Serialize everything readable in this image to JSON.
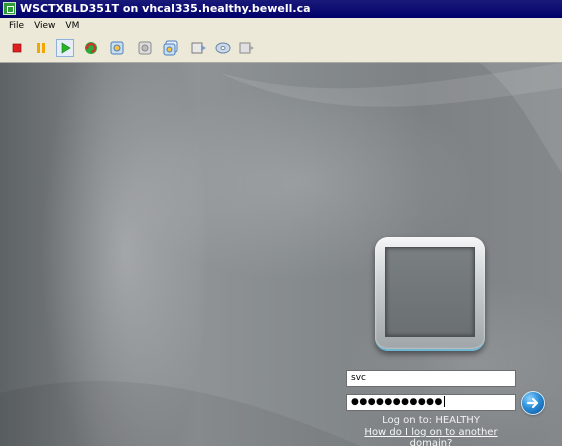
{
  "window": {
    "title": "WSCTXBLD351T on vhcal335.healthy.bewell.ca",
    "icon": "vm-console-icon"
  },
  "menu": {
    "items": [
      "File",
      "View",
      "VM"
    ]
  },
  "toolbar": {
    "buttons": [
      {
        "name": "power-off",
        "icon": "stop-icon",
        "color": "#e02020"
      },
      {
        "name": "suspend",
        "icon": "pause-icon",
        "color": "#f0a800"
      },
      {
        "name": "power-on",
        "icon": "play-icon",
        "color": "#28b428"
      },
      {
        "name": "reset",
        "icon": "reset-icon",
        "color": "#d03030"
      },
      {
        "name": "snapshot",
        "icon": "snapshot-icon"
      },
      {
        "name": "revert-snapshot",
        "icon": "revert-snapshot-icon"
      },
      {
        "name": "snapshot-manager",
        "icon": "snapshot-manager-icon"
      },
      {
        "name": "vm-settings",
        "icon": "vm-settings-icon"
      },
      {
        "name": "connect-cd",
        "icon": "cd-icon"
      },
      {
        "name": "connect-floppy",
        "icon": "floppy-icon"
      }
    ]
  },
  "login": {
    "username": "svc",
    "password_masked": "●●●●●●●●●●●",
    "logon_to": "Log on to: HEALTHY",
    "domain_link": "How do I log on to another domain?",
    "submit_icon": "arrow-right-icon"
  }
}
